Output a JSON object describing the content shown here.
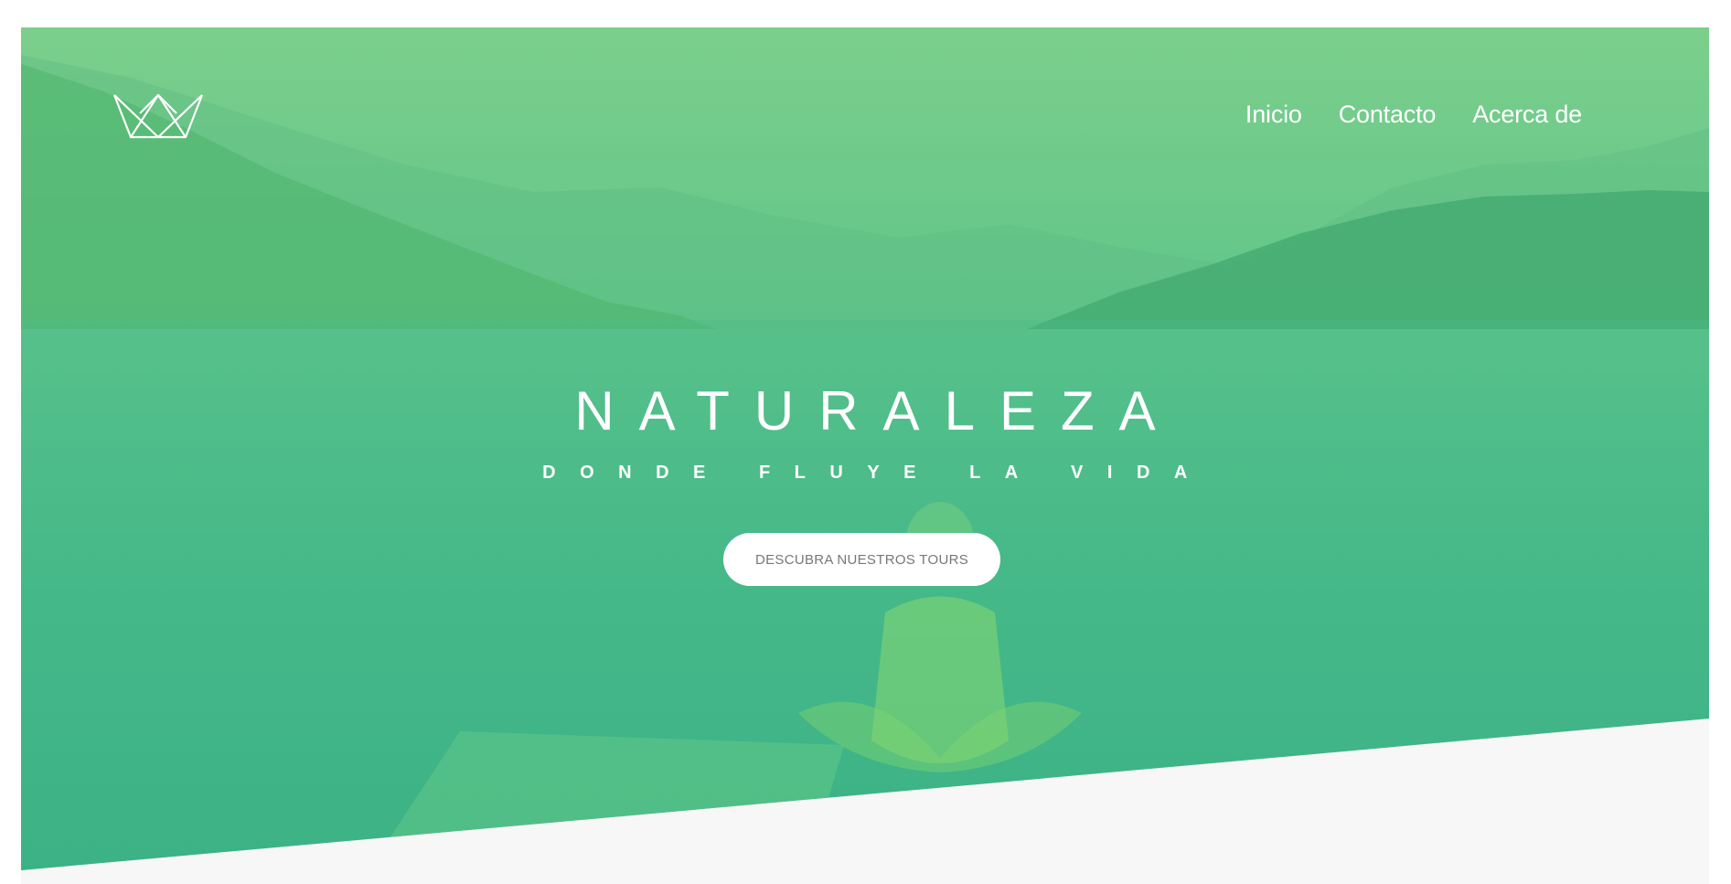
{
  "brand": {
    "logo_icon": "crown-icon"
  },
  "nav": {
    "items": [
      {
        "label": "Inicio"
      },
      {
        "label": "Contacto"
      },
      {
        "label": "Acerca de"
      }
    ]
  },
  "hero": {
    "title": "NATURALEZA",
    "subtitle": "DONDE FLUYE LA VIDA",
    "cta_label": "DESCUBRA NUESTROS TOURS",
    "overlay_colors": [
      "#7ccf8b",
      "#34ae84"
    ],
    "section_background": "#f7f7f7"
  }
}
